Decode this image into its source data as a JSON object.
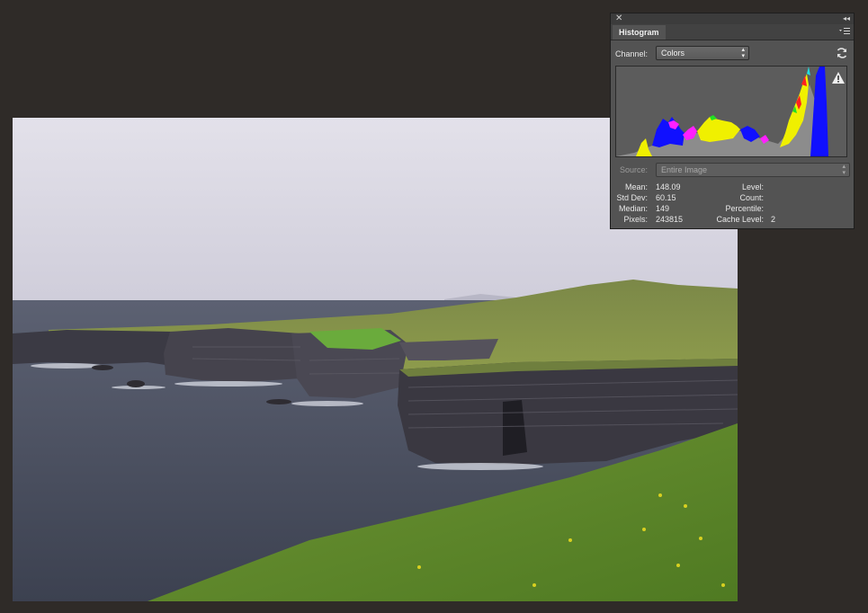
{
  "panel": {
    "close_glyph": "✕",
    "collapse_glyph": "◂◂",
    "tab_label": "Histogram",
    "channel_label": "Channel:",
    "channel_value": "Colors",
    "source_label": "Source:",
    "source_value": "Entire Image",
    "stats": {
      "mean_label": "Mean:",
      "mean": "148.09",
      "std_label": "Std Dev:",
      "std": "60.15",
      "median_label": "Median:",
      "median": "149",
      "pixels_label": "Pixels:",
      "pixels": "243815",
      "level_label": "Level:",
      "level": "",
      "count_label": "Count:",
      "count": "",
      "percentile_label": "Percentile:",
      "percentile": "",
      "cache_label": "Cache Level:",
      "cache": "2"
    },
    "icons": [
      "close-icon",
      "collapse-icon",
      "panel-menu-icon",
      "refresh-icon",
      "warning-icon",
      "dropdown-arrows-icon"
    ]
  },
  "colors": {
    "background": "#2f2b28",
    "panel": "#535353",
    "histogram_red": "#ff2020",
    "histogram_green": "#22e022",
    "histogram_blue": "#1010ff",
    "histogram_yellow": "#f0f000",
    "histogram_magenta": "#ff20ff",
    "histogram_cyan": "#20e0e0",
    "histogram_gray": "#8c8c8c"
  }
}
